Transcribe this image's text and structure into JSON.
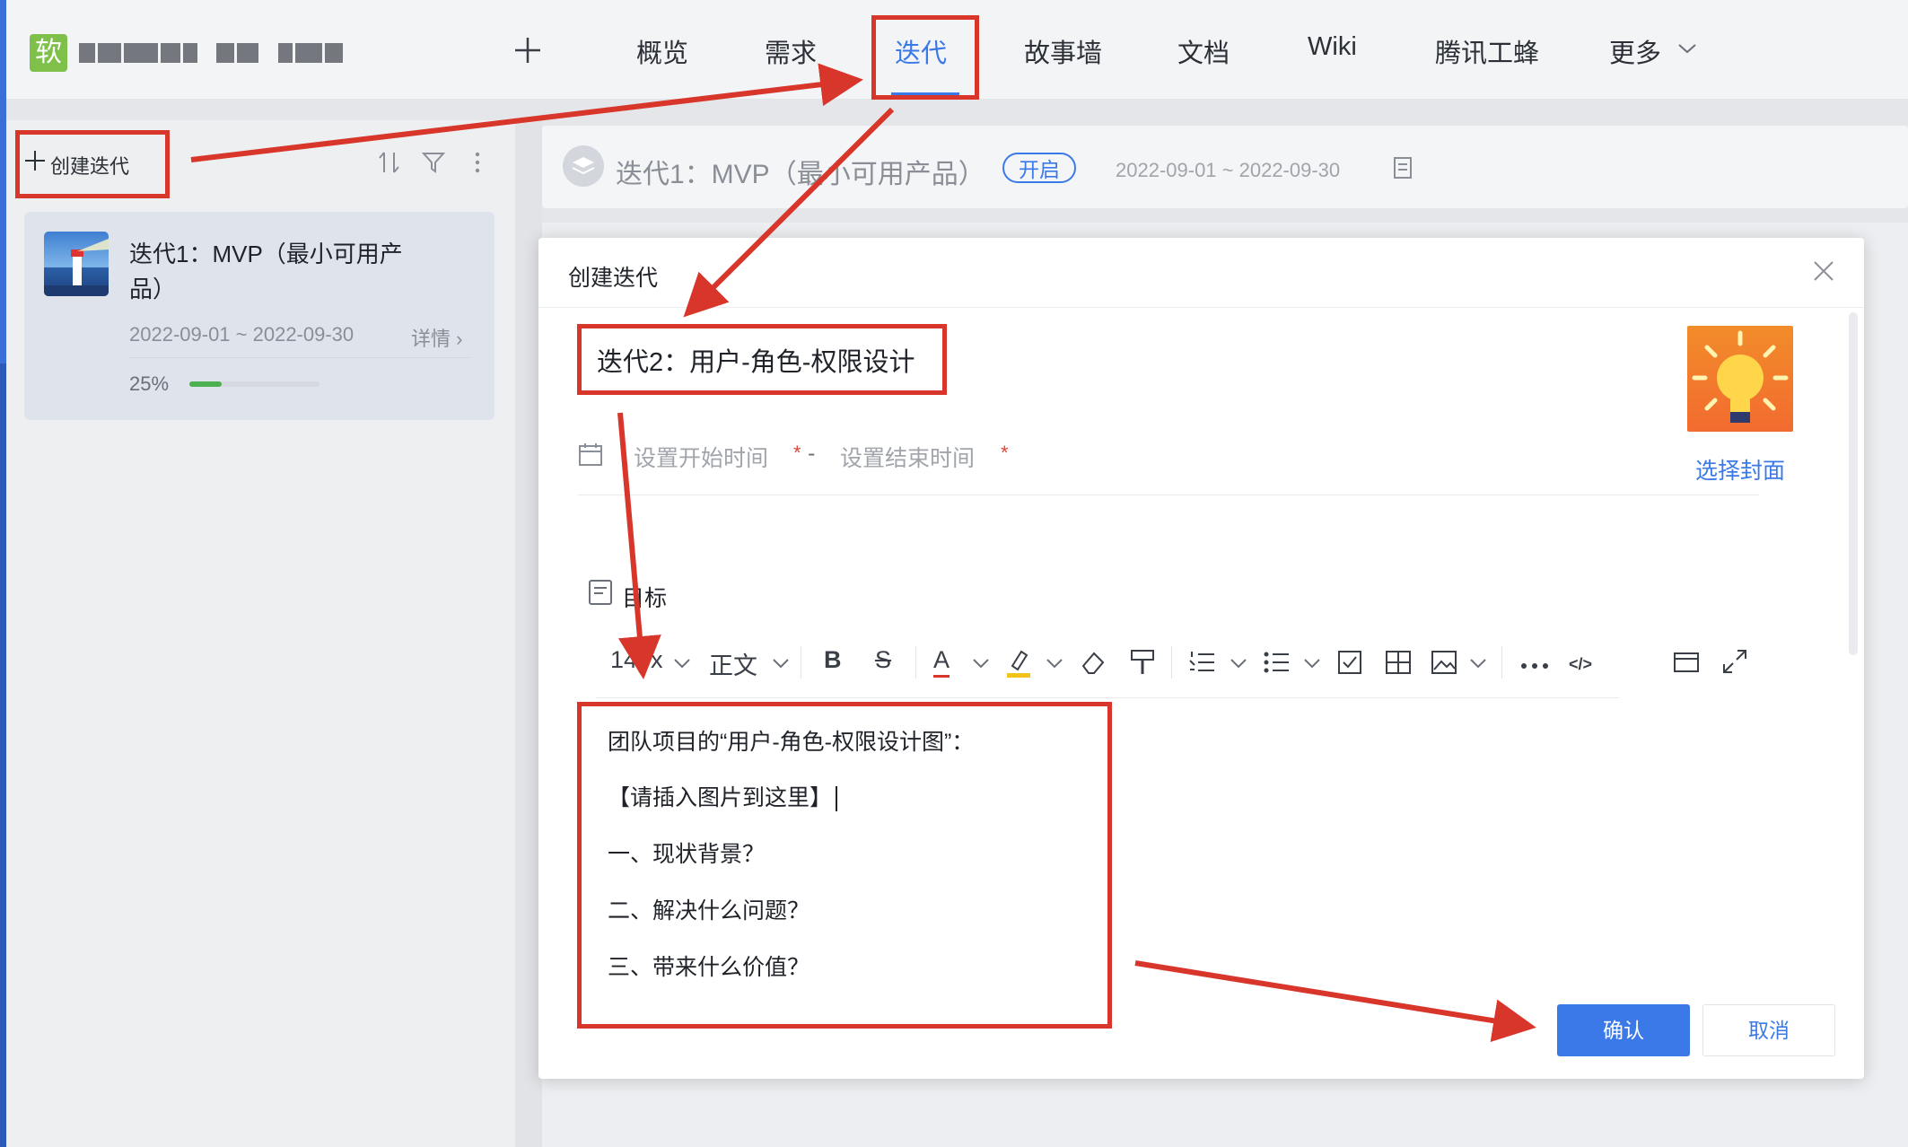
{
  "header": {
    "logo_char": "软",
    "add_icon": "plus-icon",
    "nav": [
      "概览",
      "需求",
      "迭代",
      "故事墙",
      "文档",
      "Wiki",
      "腾讯工蜂",
      "更多"
    ],
    "active_nav": "迭代"
  },
  "sidebar": {
    "create_label": "创建迭代",
    "iteration": {
      "title_line1": "迭代1：MVP（最小可用产",
      "title_line2": "品）",
      "dates": "2022-09-01 ~ 2022-09-30",
      "detail": "详情",
      "progress_text": "25%",
      "progress": 0.25
    }
  },
  "iteration_header": {
    "title": "迭代1：MVP（最小可用产品）",
    "status": "开启",
    "dates": "2022-09-01 ~ 2022-09-30"
  },
  "modal": {
    "title": "创建迭代",
    "name_value": "迭代2：用户-角色-权限设计",
    "start_placeholder": "设置开始时间",
    "end_placeholder": "设置结束时间",
    "required_mark": "*",
    "range_sep": "-",
    "cover_label": "选择封面",
    "goal_label": "目标",
    "toolbar": {
      "font_size": "14px",
      "paragraph": "正文"
    },
    "editor_lines": [
      "团队项目的“用户-角色-权限设计图”：",
      "【请插入图片到这里】",
      "一、现状背景？",
      "二、解决什么问题？",
      "三、带来什么价值？"
    ],
    "confirm": "确认",
    "cancel": "取消"
  },
  "colors": {
    "accent": "#3b79e8",
    "annotation": "#d9362b",
    "progress": "#4caf50"
  }
}
